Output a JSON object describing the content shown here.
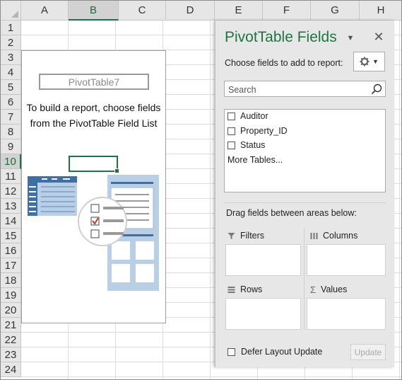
{
  "sheet": {
    "columns": [
      "A",
      "B",
      "C",
      "D",
      "E",
      "F",
      "G",
      "H"
    ],
    "selected_column": "B",
    "rows": [
      "1",
      "2",
      "3",
      "4",
      "5",
      "6",
      "7",
      "8",
      "9",
      "10",
      "11",
      "12",
      "13",
      "14",
      "15",
      "16",
      "17",
      "18",
      "19",
      "20",
      "21",
      "22",
      "23",
      "24"
    ],
    "selected_row": "10"
  },
  "pivot": {
    "name": "PivotTable7",
    "message": "To build a report, choose fields\nfrom the PivotTable Field List"
  },
  "pane": {
    "title": "PivotTable Fields",
    "choose_label": "Choose fields to add to report:",
    "search_placeholder": "Search",
    "fields": [
      {
        "label": "Auditor",
        "checked": false
      },
      {
        "label": "Property_ID",
        "checked": false
      },
      {
        "label": "Status",
        "checked": false
      }
    ],
    "more_tables": "More Tables...",
    "drag_label": "Drag fields between areas below:",
    "areas": {
      "filters": "Filters",
      "columns": "Columns",
      "rows": "Rows",
      "values": "Values"
    },
    "defer_label": "Defer Layout Update",
    "update_label": "Update"
  },
  "colors": {
    "excel_green": "#217346",
    "illustration_blue": "#3d6fa8",
    "illustration_light": "#b9cfe6",
    "check_red": "#c0392b"
  },
  "icons": [
    "dropdown-arrow-icon",
    "close-icon",
    "gear-icon",
    "search-icon",
    "filter-icon",
    "columns-icon",
    "rows-icon",
    "sigma-icon"
  ]
}
